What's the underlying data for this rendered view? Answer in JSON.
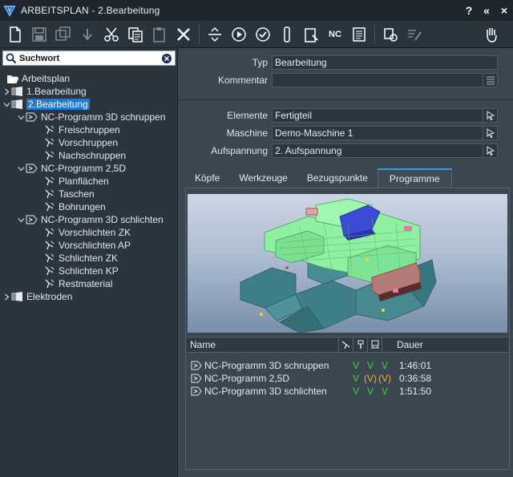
{
  "window": {
    "title": "ARBEITSPLAN - 2.Bearbeitung"
  },
  "titlebar_buttons": [
    "?",
    "«",
    "×"
  ],
  "toolbar": {
    "icons": [
      "new-doc-icon",
      "save-icon",
      "save-all-icon",
      "undo-icon",
      "cut-icon",
      "copy-icon",
      "paste-icon",
      "delete-icon",
      "split-icon",
      "play-icon",
      "check-icon",
      "tool-icon",
      "clipboard-icon",
      "nc-icon",
      "list-icon",
      "robot-icon",
      "edit-icon",
      "hand-icon"
    ],
    "nc_label": "NC"
  },
  "search": {
    "placeholder": "Suchwort",
    "value": ""
  },
  "tree": {
    "root": "Arbeitsplan",
    "items": [
      {
        "label": "1.Bearbeitung",
        "level": 1,
        "expander": "right",
        "selected": false,
        "icon": "bearbeitung"
      },
      {
        "label": "2.Bearbeitung",
        "level": 1,
        "expander": "down",
        "selected": true,
        "icon": "bearbeitung"
      },
      {
        "label": "NC-Programm 3D schruppen",
        "level": 2,
        "expander": "down",
        "icon": "ncprog"
      },
      {
        "label": "Freischruppen",
        "level": 3,
        "icon": "op"
      },
      {
        "label": "Vorschruppen",
        "level": 3,
        "icon": "op"
      },
      {
        "label": "Nachschruppen",
        "level": 3,
        "icon": "op"
      },
      {
        "label": "NC-Programm 2,5D",
        "level": 2,
        "expander": "down",
        "icon": "ncprog"
      },
      {
        "label": "Planflächen",
        "level": 3,
        "icon": "op"
      },
      {
        "label": "Taschen",
        "level": 3,
        "icon": "op"
      },
      {
        "label": "Bohrungen",
        "level": 3,
        "icon": "op"
      },
      {
        "label": "NC-Programm 3D schlichten",
        "level": 2,
        "expander": "down",
        "icon": "ncprog"
      },
      {
        "label": "Vorschlichten ZK",
        "level": 3,
        "icon": "op"
      },
      {
        "label": "Vorschlichten AP",
        "level": 3,
        "icon": "op"
      },
      {
        "label": "Schlichten ZK",
        "level": 3,
        "icon": "op"
      },
      {
        "label": "Schlichten KP",
        "level": 3,
        "icon": "op"
      },
      {
        "label": "Restmaterial",
        "level": 3,
        "icon": "op"
      },
      {
        "label": "Elektroden",
        "level": 1,
        "expander": "right",
        "icon": "bearbeitung"
      }
    ]
  },
  "properties": {
    "typ_label": "Typ",
    "typ_value": "Bearbeitung",
    "kommentar_label": "Kommentar",
    "kommentar_value": "",
    "elemente_label": "Elemente",
    "elemente_value": "Fertigteil",
    "maschine_label": "Maschine",
    "maschine_value": "Demo-Maschine 1",
    "aufspannung_label": "Aufspannung",
    "aufspannung_value": "2. Aufspannung"
  },
  "tabs": [
    {
      "label": "Köpfe",
      "active": false
    },
    {
      "label": "Werkzeuge",
      "active": false
    },
    {
      "label": "Bezugspunkte",
      "active": false
    },
    {
      "label": "Programme",
      "active": true
    }
  ],
  "programs": {
    "headers": {
      "name": "Name",
      "duration": "Dauer"
    },
    "header_icons": [
      "toolpath-icon",
      "tool-icon",
      "machine-icon"
    ],
    "rows": [
      {
        "name": "NC-Programm 3D schruppen",
        "s1": "V",
        "s2": "V",
        "s3": "V",
        "s1_state": "ok",
        "s2_state": "ok",
        "s3_state": "ok",
        "duration": "1:46:01"
      },
      {
        "name": "NC-Programm 2,5D",
        "s1": "V",
        "s2": "(V)",
        "s3": "(V)",
        "s1_state": "ok",
        "s2_state": "warn",
        "s3_state": "warn",
        "duration": "0:36:58"
      },
      {
        "name": "NC-Programm 3D schlichten",
        "s1": "V",
        "s2": "V",
        "s3": "V",
        "s1_state": "ok",
        "s2_state": "ok",
        "s3_state": "ok",
        "duration": "1:51:50"
      }
    ]
  },
  "colors": {
    "accent": "#1f78d1",
    "ok": "#3ed43e",
    "warn": "#e7b53b",
    "tab_active": "#3a9be0"
  }
}
